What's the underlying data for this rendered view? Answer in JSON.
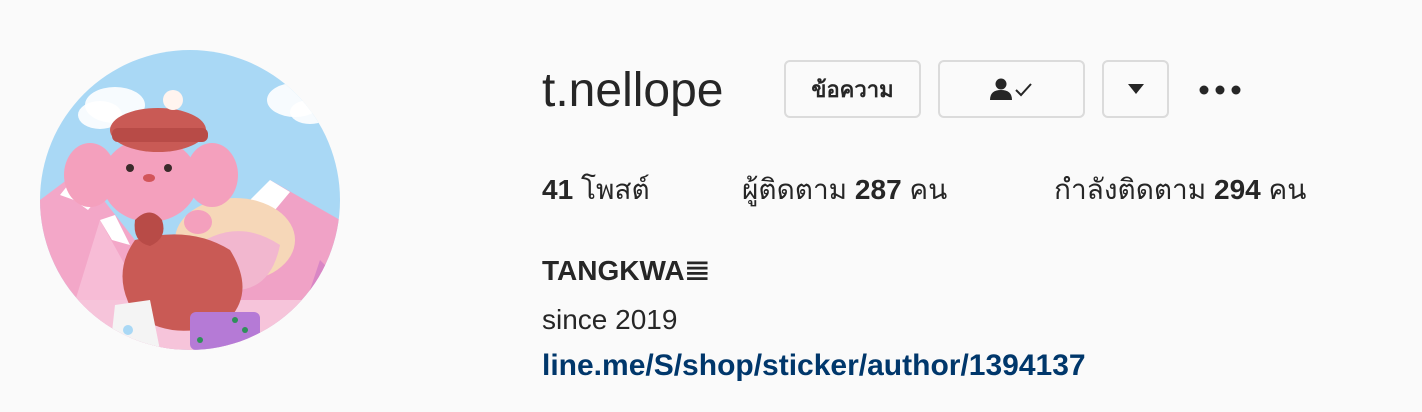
{
  "profile": {
    "username": "t.nellope",
    "full_name": "TANGKWA𝌆",
    "bio": "since 2019",
    "link": "line.me/S/shop/sticker/author/1394137"
  },
  "actions": {
    "message_label": "ข้อความ",
    "following_icon": "person-check-icon",
    "dropdown_icon": "caret-down-icon",
    "more_icon": "ellipsis-icon"
  },
  "stats": {
    "posts_count": "41",
    "posts_label": "โพสต์",
    "followers_label": "ผู้ติดตาม",
    "followers_count": "287",
    "followers_unit": "คน",
    "following_label": "กำลังติดตาม",
    "following_count": "294",
    "following_unit": "คน"
  },
  "colors": {
    "background": "#fafafa",
    "text": "#262626",
    "link": "#00376b",
    "border": "#dbdbdb"
  }
}
